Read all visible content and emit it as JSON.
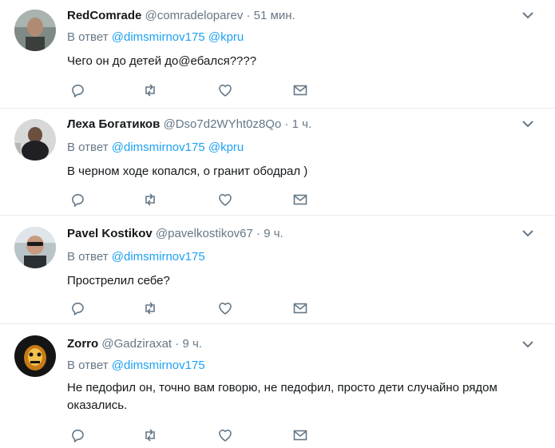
{
  "reply_prefix": "В ответ",
  "tweets": [
    {
      "name": "RedComrade",
      "handle": "@comradeloparev",
      "time": "51 мин.",
      "mentions": [
        "@dimsmirnov175",
        "@kpru"
      ],
      "text": "Чего он до детей до@ебался????"
    },
    {
      "name": "Леха Богатиков",
      "handle": "@Dso7d2WYht0z8Qo",
      "time": "1 ч.",
      "mentions": [
        "@dimsmirnov175",
        "@kpru"
      ],
      "text": "В черном ходе копался, о гранит ободрал )"
    },
    {
      "name": "Pavel Kostikov",
      "handle": "@pavelkostikov67",
      "time": "9 ч.",
      "mentions": [
        "@dimsmirnov175"
      ],
      "text": "Прострелил себе?"
    },
    {
      "name": "Zorro",
      "handle": "@Gadziraxat",
      "time": "9 ч.",
      "mentions": [
        "@dimsmirnov175"
      ],
      "text": "Не педофил он, точно вам говорю, не педофил, просто дети случайно рядом оказались."
    }
  ],
  "icons": {
    "reply": "reply-icon",
    "retweet": "retweet-icon",
    "like": "heart-icon",
    "dm": "envelope-icon",
    "menu": "chevron-down-icon"
  },
  "colors": {
    "link": "#1da1f2",
    "muted": "#657786",
    "text": "#14171a",
    "border": "#e6ecf0"
  }
}
